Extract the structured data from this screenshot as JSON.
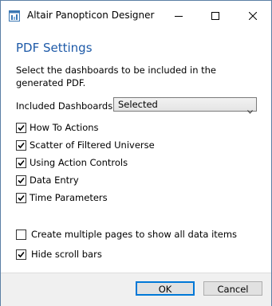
{
  "window": {
    "title": "Altair Panopticon Designer",
    "icon": "app-icon",
    "controls": [
      "minimize-icon",
      "maximize-icon",
      "close-icon"
    ]
  },
  "dialog": {
    "heading": "PDF Settings",
    "description": "Select the dashboards to be included in the generated PDF.",
    "included_dashboards": {
      "label": "Included Dashboards",
      "selected": "Selected"
    },
    "dashboards": [
      {
        "label": "How To Actions",
        "checked": true
      },
      {
        "label": "Scatter of Filtered Universe",
        "checked": true
      },
      {
        "label": "Using Action Controls",
        "checked": true
      },
      {
        "label": "Data Entry",
        "checked": true
      },
      {
        "label": "Time Parameters",
        "checked": true
      }
    ],
    "options": [
      {
        "label": "Create multiple pages to show all data items",
        "checked": false
      },
      {
        "label": "Hide scroll bars",
        "checked": true
      }
    ]
  },
  "buttons": {
    "ok": "OK",
    "cancel": "Cancel"
  },
  "colors": {
    "heading": "#1e5aa8",
    "window_border": "#5b7fa5",
    "footer_bg": "#f0f0f0",
    "default_button_border": "#0078d7"
  }
}
